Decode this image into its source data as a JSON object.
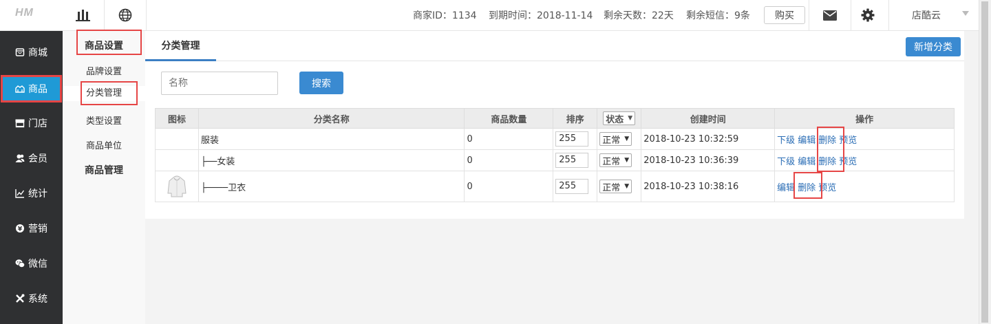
{
  "top": {
    "logo": "HM",
    "merchant_id": "商家ID：1134",
    "expiry": "到期时间：2018-11-14",
    "days_left": "剩余天数：22天",
    "sms_left": "剩余短信：9条",
    "buy": "购买",
    "user": "店酷云"
  },
  "sidebar": {
    "items": [
      {
        "label": "商城",
        "icon": "shop-icon"
      },
      {
        "label": "商品",
        "icon": "goods-icon"
      },
      {
        "label": "门店",
        "icon": "store-icon"
      },
      {
        "label": "会员",
        "icon": "member-icon"
      },
      {
        "label": "统计",
        "icon": "chart-icon"
      },
      {
        "label": "营销",
        "icon": "marketing-icon"
      },
      {
        "label": "微信",
        "icon": "wechat-icon"
      },
      {
        "label": "系统",
        "icon": "tools-icon"
      }
    ]
  },
  "subnav": {
    "group1": "商品设置",
    "items1": [
      "品牌设置",
      "分类管理",
      "类型设置",
      "商品单位"
    ],
    "group2": "商品管理"
  },
  "main": {
    "tab": "分类管理",
    "add_button": "新增分类",
    "search_placeholder": "名称",
    "search_button": "搜索",
    "columns": [
      "图标",
      "分类名称",
      "商品数量",
      "排序",
      "状态",
      "创建时间",
      "操作"
    ],
    "rows": [
      {
        "name": "服装",
        "count": "0",
        "sort": "255",
        "status": "正常",
        "created": "2018-10-23 10:32:59",
        "ops": [
          "下级",
          "编辑",
          "删除",
          "预览"
        ]
      },
      {
        "name": "├──女装",
        "count": "0",
        "sort": "255",
        "status": "正常",
        "created": "2018-10-23 10:36:39",
        "ops": [
          "下级",
          "编辑",
          "删除",
          "预览"
        ]
      },
      {
        "name": "├────卫衣",
        "count": "0",
        "sort": "255",
        "status": "正常",
        "created": "2018-10-23 10:38:16",
        "ops": [
          "编辑",
          "删除",
          "预览"
        ]
      }
    ]
  },
  "colors": {
    "accent": "#3a8ad1",
    "sidebar_bg": "#2f3032",
    "active": "#1f9ad6",
    "highlight": "#e64545"
  }
}
